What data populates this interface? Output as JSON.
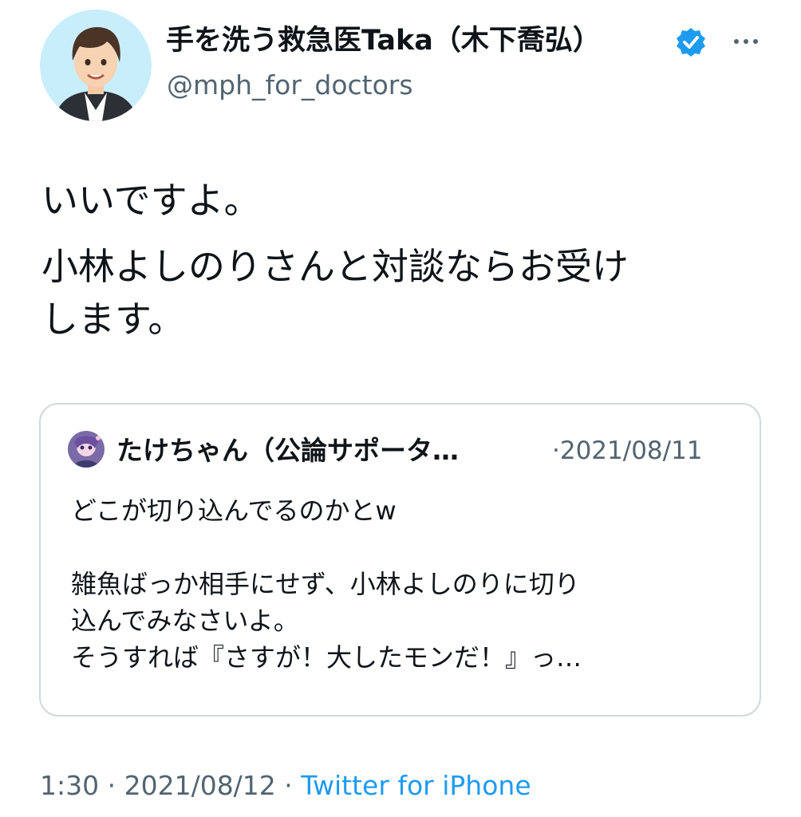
{
  "author": {
    "display_name": "手を洗う救急医Taka（木下喬弘）",
    "handle": "@mph_for_doctors",
    "avatar_icon": "illustrated-avatar-icon",
    "verified_icon": "verified-badge-icon"
  },
  "tweet": {
    "paragraphs": [
      "いいですよ。",
      "小林よしのりさんと対談ならお受け",
      "します。"
    ]
  },
  "quote": {
    "author_name": "たけちゃん（公論サポータ…",
    "date": "·2021/08/11",
    "lines": [
      "どこが切り込んでるのかとw",
      "",
      "雑魚ばっか相手にせず、小林よしのりに切り",
      "込んでみなさいよ。",
      "そうすれば『さすが！大したモンだ！』っ…"
    ]
  },
  "footer": {
    "time": "1:30",
    "sep1": " · ",
    "date": "2021/08/12",
    "sep2": " · ",
    "source": "Twitter for iPhone"
  },
  "colors": {
    "text": "#0f1419",
    "secondary": "#536471",
    "accent": "#1d9bf0",
    "border": "#cfd9de"
  }
}
